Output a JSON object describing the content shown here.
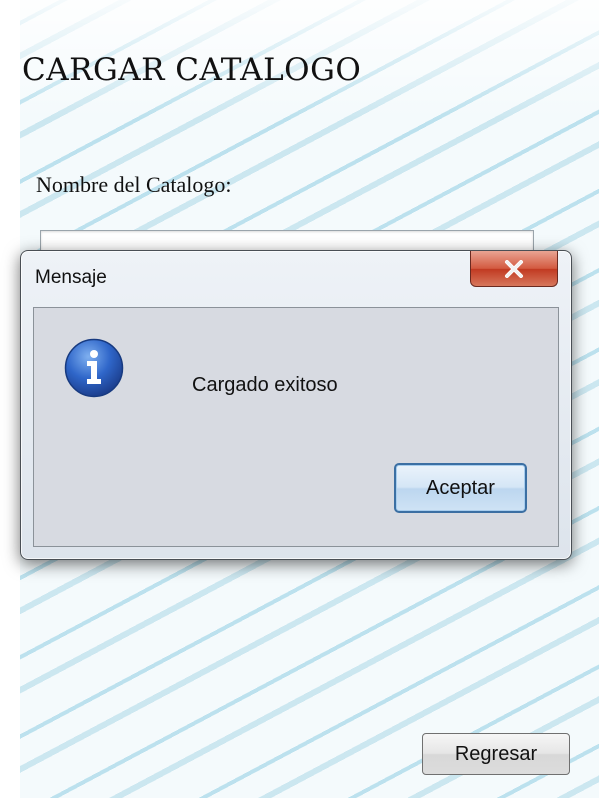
{
  "window": {
    "title": "CARGAR CATALOGO",
    "field_label": "Nombre del Catalogo:",
    "field_value": "",
    "back_button": "Regresar"
  },
  "dialog": {
    "title": "Mensaje",
    "message": "Cargado exitoso",
    "ok_button": "Aceptar",
    "icon": "info-icon",
    "close_icon": "close-icon"
  },
  "colors": {
    "info_blue": "#2a63c6",
    "close_red": "#c9472e",
    "ok_border": "#3b6fa3"
  }
}
